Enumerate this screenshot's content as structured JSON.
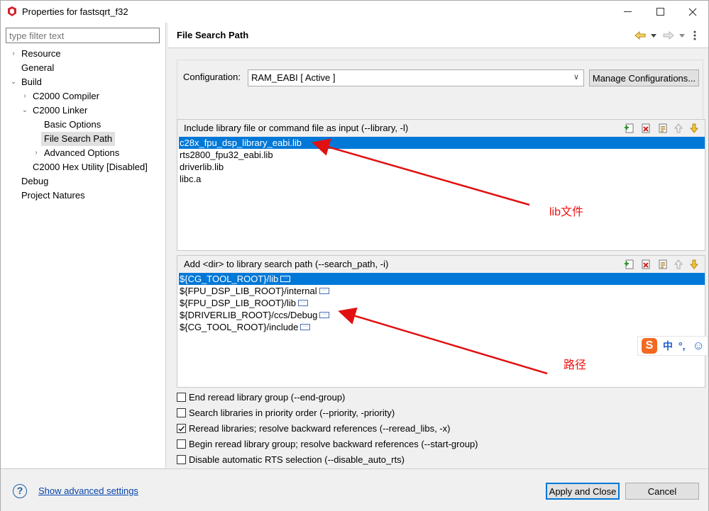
{
  "window": {
    "title": "Properties for fastsqrt_f32"
  },
  "filter": {
    "placeholder": "type filter text"
  },
  "tree": {
    "resource": "Resource",
    "general": "General",
    "build": "Build",
    "c2000_compiler": "C2000 Compiler",
    "c2000_linker": "C2000 Linker",
    "basic_options": "Basic Options",
    "file_search_path": "File Search Path",
    "advanced_options": "Advanced Options",
    "c2000_hex_utility": "C2000 Hex Utility  [Disabled]",
    "debug": "Debug",
    "project_natures": "Project Natures"
  },
  "page": {
    "title": "File Search Path"
  },
  "configuration": {
    "label": "Configuration:",
    "value": "RAM_EABI  [ Active ]",
    "manage_label": "Manage Configurations..."
  },
  "include_libs": {
    "title": "Include library file or command file as input (--library, -l)",
    "items": [
      "c28x_fpu_dsp_library_eabi.lib",
      "rts2800_fpu32_eabi.lib",
      "driverlib.lib",
      "libc.a"
    ]
  },
  "search_paths": {
    "title": "Add <dir> to library search path (--search_path, -i)",
    "items": [
      "${CG_TOOL_ROOT}/lib",
      "${FPU_DSP_LIB_ROOT}/internal",
      "${FPU_DSP_LIB_ROOT}/lib",
      "${DRIVERLIB_ROOT}/ccs/Debug",
      "${CG_TOOL_ROOT}/include"
    ]
  },
  "options": [
    {
      "label": "End reread library group (--end-group)",
      "checked": false
    },
    {
      "label": "Search libraries in priority order (--priority, -priority)",
      "checked": false
    },
    {
      "label": "Reread libraries; resolve backward references (--reread_libs, -x)",
      "checked": true
    },
    {
      "label": "Begin reread library group; resolve backward references (--start-group)",
      "checked": false
    },
    {
      "label": "Disable automatic RTS selection (--disable_auto_rts)",
      "checked": false
    }
  ],
  "footer": {
    "advanced_link": "Show advanced settings",
    "apply_close": "Apply and Close",
    "cancel": "Cancel"
  },
  "annotations": {
    "lib_note": "lib文件",
    "path_note": "路径",
    "color": "#e11111"
  },
  "ime": {
    "logo": "S",
    "mode": "中",
    "punct": "°,"
  },
  "colors": {
    "selection": "#0078d7",
    "link": "#0645ad"
  }
}
